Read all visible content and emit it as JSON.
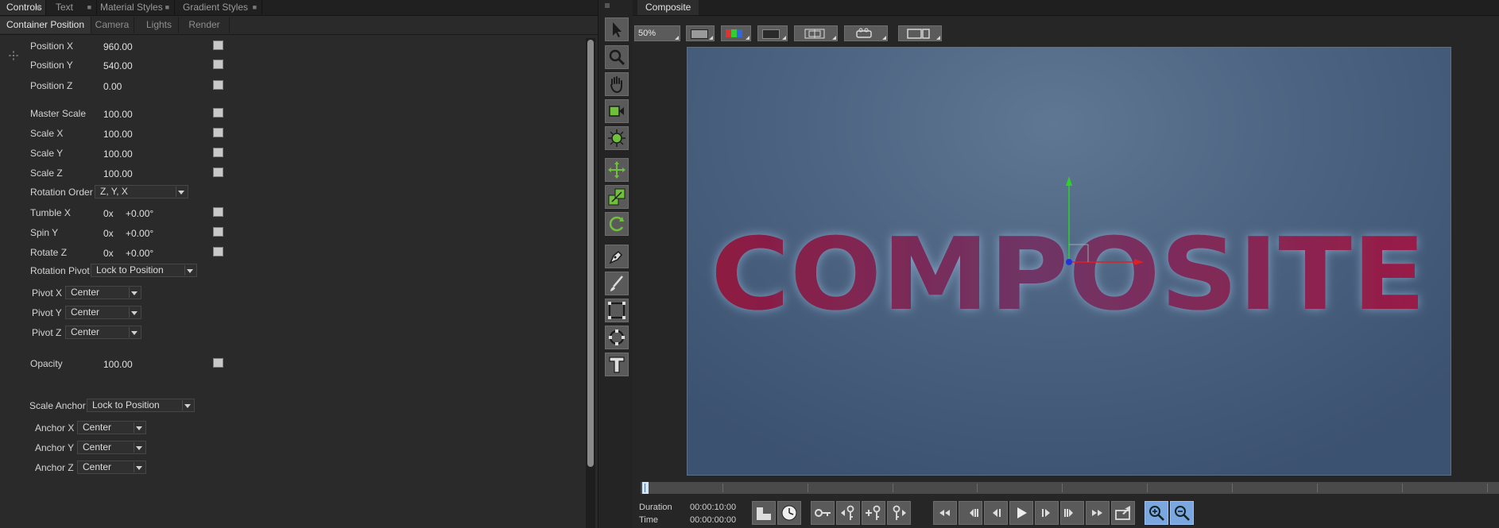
{
  "left_panel": {
    "top_tabs": [
      "Controls",
      "Text",
      "Material Styles",
      "Gradient Styles"
    ],
    "sub_tabs": [
      "Container Position",
      "Camera",
      "Lights",
      "Render"
    ],
    "props": [
      {
        "label": "Position X",
        "value": "960.00"
      },
      {
        "label": "Position Y",
        "value": "540.00"
      },
      {
        "label": "Position Z",
        "value": "0.00"
      },
      {
        "label": "Master Scale",
        "value": "100.00"
      },
      {
        "label": "Scale X",
        "value": "100.00"
      },
      {
        "label": "Scale Y",
        "value": "100.00"
      },
      {
        "label": "Scale Z",
        "value": "100.00"
      }
    ],
    "rotation_order": {
      "label": "Rotation Order",
      "value": "Z, Y, X"
    },
    "rotations": [
      {
        "label": "Tumble X",
        "turns": "0x",
        "value": "+0.00°"
      },
      {
        "label": "Spin Y",
        "turns": "0x",
        "value": "+0.00°"
      },
      {
        "label": "Rotate Z",
        "turns": "0x",
        "value": "+0.00°"
      }
    ],
    "rotation_pivot": {
      "label": "Rotation Pivot",
      "value": "Lock to Position"
    },
    "pivots": [
      {
        "label": "Pivot X",
        "value": "Center"
      },
      {
        "label": "Pivot Y",
        "value": "Center"
      },
      {
        "label": "Pivot Z",
        "value": "Center"
      }
    ],
    "opacity": {
      "label": "Opacity",
      "value": "100.00"
    },
    "scale_anchor": {
      "label": "Scale Anchor",
      "value": "Lock to Position"
    },
    "anchors": [
      {
        "label": "Anchor X",
        "value": "Center"
      },
      {
        "label": "Anchor Y",
        "value": "Center"
      },
      {
        "label": "Anchor Z",
        "value": "Center"
      }
    ]
  },
  "tools": [
    "select-arrow-icon",
    "zoom-magnifier-icon",
    "pan-hand-icon",
    "camera-icon",
    "light-icon",
    "move-icon",
    "scale-icon",
    "rotate-icon",
    "pen-icon",
    "brush-icon",
    "rectangle-icon",
    "ellipse-icon",
    "text-tool-icon"
  ],
  "viewer": {
    "tab": "Composite",
    "zoom": "50%",
    "canvas_text": "COMPOSITE",
    "duration_label": "Duration",
    "duration_value": "00:00:10:00",
    "time_label": "Time",
    "time_value": "00:00:00:00"
  },
  "colors": {
    "text_gradient_start": "#8b1a3e",
    "text_gradient_end": "#9a1c45",
    "canvas_bg": "#4d6582",
    "accent_blue": "#7aa7e0"
  }
}
